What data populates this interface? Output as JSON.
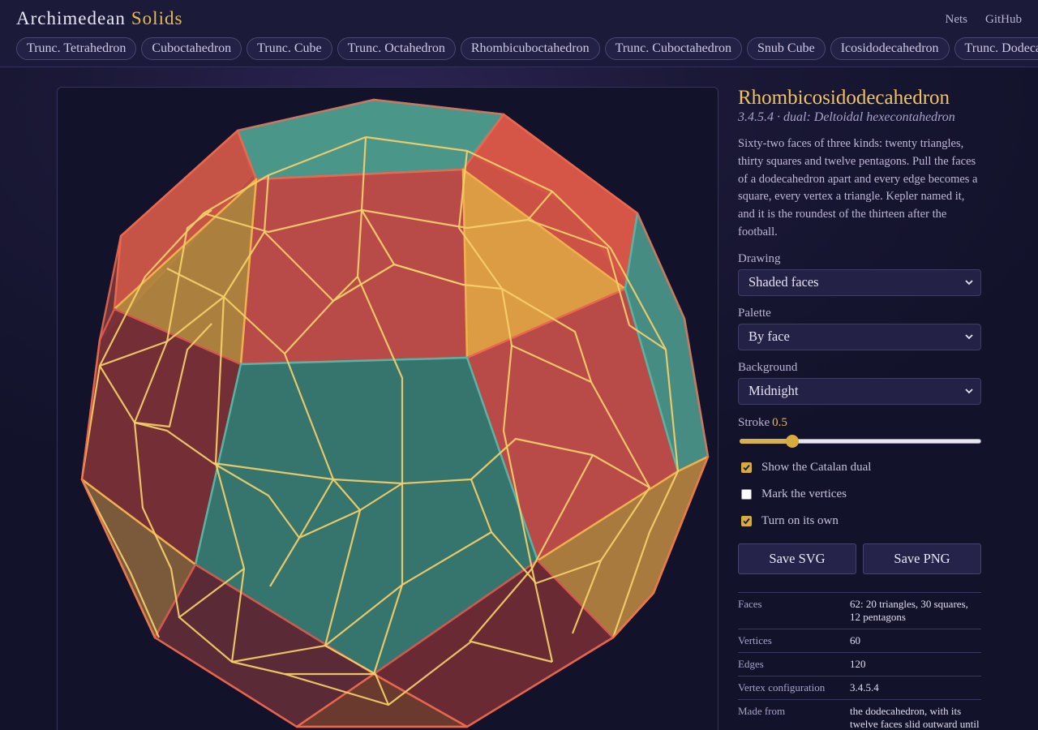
{
  "brand": {
    "word1": "Archimedean",
    "word2": "Solids"
  },
  "top_links": [
    "Nets",
    "GitHub"
  ],
  "solid_tabs": [
    "Trunc. Tetrahedron",
    "Cuboctahedron",
    "Trunc. Cube",
    "Trunc. Octahedron",
    "Rhombicuboctahedron",
    "Trunc. Cuboctahedron",
    "Snub Cube",
    "Icosidodecahedron",
    "Trunc. Dodecahedron"
  ],
  "solid": {
    "name": "Rhombicosidodecahedron",
    "subtitle": "3.4.5.4 · dual: Deltoidal hexecontahedron",
    "description": "Sixty-two faces of three kinds: twenty triangles, thirty squares and twelve pentagons. Pull the faces of a dodecahedron apart and every edge becomes a square, every vertex a triangle. Kepler named it, and it is the roundest of the thirteen after the football."
  },
  "controls": {
    "drawing": {
      "label": "Drawing",
      "value": "Shaded faces"
    },
    "palette": {
      "label": "Palette",
      "value": "By face"
    },
    "background": {
      "label": "Background",
      "value": "Midnight"
    },
    "stroke": {
      "label": "Stroke",
      "value": "0.5",
      "fraction": 0.22
    },
    "checks": [
      {
        "label": "Show the Catalan dual",
        "checked": true
      },
      {
        "label": "Mark the vertices",
        "checked": false
      },
      {
        "label": "Turn on its own",
        "checked": true
      }
    ],
    "save_svg": "Save SVG",
    "save_png": "Save PNG"
  },
  "stats": [
    {
      "key": "Faces",
      "value": "62: 20 triangles, 30 squares, 12 pentagons"
    },
    {
      "key": "Vertices",
      "value": "60"
    },
    {
      "key": "Edges",
      "value": "120"
    },
    {
      "key": "Vertex configuration",
      "value": "3.4.5.4"
    },
    {
      "key": "Made from",
      "value": "the dodecahedron, with its twelve faces slid outward until the gaps close into squares"
    }
  ],
  "colors": {
    "triangle": "#e55a4a",
    "square": "#e8a445",
    "pentagon": "#4ea898",
    "dual_stroke": "#f5cf6a",
    "accent": "#e5bb52"
  },
  "icons": {
    "select": "chevron-down-icon",
    "checkbox": "check-icon"
  }
}
